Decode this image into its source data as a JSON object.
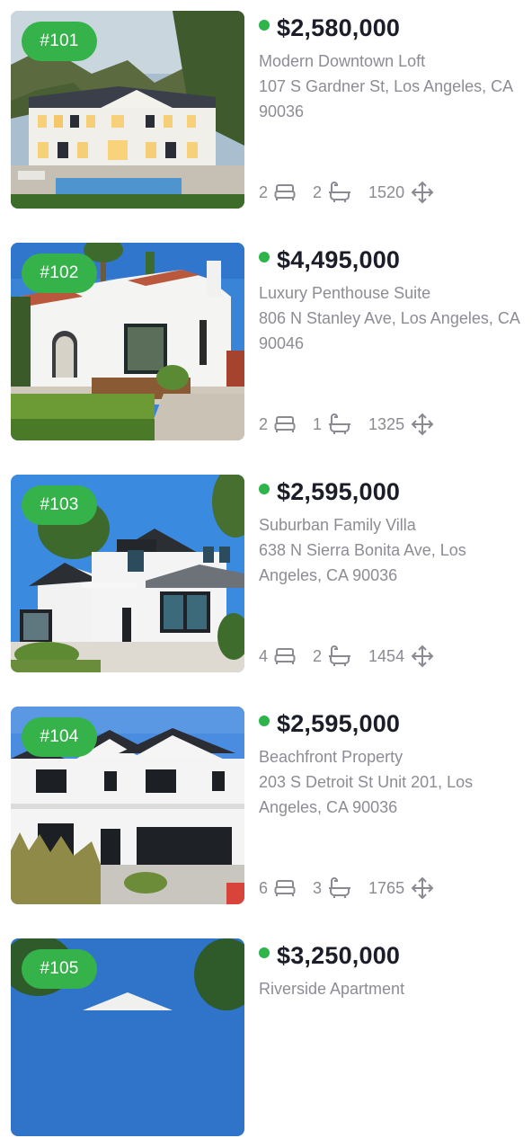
{
  "listings": [
    {
      "id": "#101",
      "price": "$2,580,000",
      "title": "Modern Downtown Loft",
      "address": "107 S Gardner St, Los Angeles, CA 90036",
      "beds": "2",
      "baths": "2",
      "sqft": "1520",
      "photo": {
        "sky": "#9ab4c8",
        "house": "#f3f1ec",
        "roof": "#3b3f49",
        "accent": "#4a8fc9",
        "ground": "#4d7a3a",
        "style": "colonial-with-pool"
      }
    },
    {
      "id": "#102",
      "price": "$4,495,000",
      "title": "Luxury Penthouse Suite",
      "address": "806 N Stanley Ave, Los Angeles, CA 90046",
      "beds": "2",
      "baths": "1",
      "sqft": "1325",
      "photo": {
        "sky": "#3f86d6",
        "house": "#f6f6f4",
        "roof": "#b8563b",
        "accent": "#2a2a2a",
        "ground": "#5f8f36",
        "style": "spanish-white"
      }
    },
    {
      "id": "#103",
      "price": "$2,595,000",
      "title": "Suburban Family Villa",
      "address": "638 N Sierra Bonita Ave, Los Angeles, CA 90036",
      "beds": "4",
      "baths": "2",
      "sqft": "1454",
      "photo": {
        "sky": "#3d8ae0",
        "house": "#f2f2f2",
        "roof": "#2b2e33",
        "accent": "#1f2328",
        "ground": "#6a8d3c",
        "style": "modern-farmhouse"
      }
    },
    {
      "id": "#104",
      "price": "$2,595,000",
      "title": "Beachfront Property",
      "address": "203 S Detroit St Unit 201, Los Angeles, CA 90036",
      "beds": "6",
      "baths": "3",
      "sqft": "1765",
      "photo": {
        "sky": "#4d8ee0",
        "house": "#f4f4f4",
        "roof": "#2a2d33",
        "accent": "#1c1f24",
        "ground": "#8a8f4a",
        "style": "white-gables"
      }
    },
    {
      "id": "#105",
      "price": "$3,250,000",
      "title": "Riverside Apartment",
      "address": "",
      "beds": "",
      "baths": "",
      "sqft": "",
      "photo": {
        "sky": "#2f74c9",
        "house": "#f0f0ee",
        "roof": "#2a2d33",
        "accent": "#1c1f24",
        "ground": "#2f5a2a",
        "style": "partial"
      }
    }
  ],
  "icons": {
    "bed": "bed-icon",
    "bath": "bathtub-icon",
    "area": "move-arrows-icon",
    "status": "status-dot-icon"
  }
}
